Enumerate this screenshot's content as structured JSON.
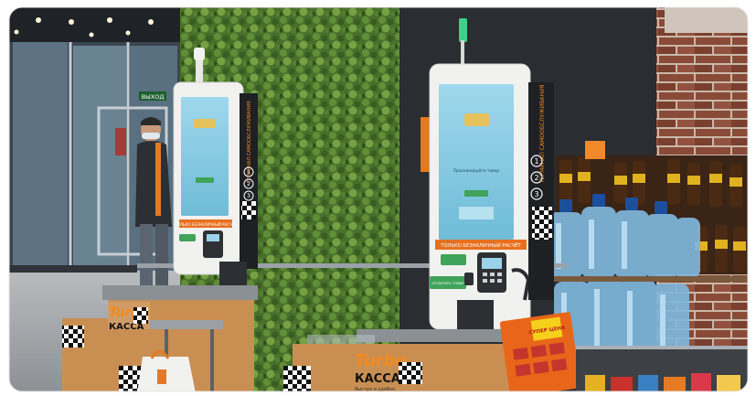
{
  "exit_sign": "ВЫХОД",
  "kiosk_left": {
    "banner": "ТОЛЬКО БЕЗНАЛИЧНЫЙ РАСЧЁТ",
    "side_panel": "ТЕРМИНАЛ САМООБСЛУЖИВАНИЯ",
    "steps": [
      "1",
      "2",
      "3"
    ]
  },
  "kiosk_right": {
    "screen_prompt": "Просканируйте товар",
    "banner": "ТОЛЬКО БЕЗНАЛИЧНЫЙ РАСЧЁТ",
    "side_panel": "ТЕРМИНАЛ САМООБСЛУЖИВАНИЯ",
    "steps": [
      "1",
      "2",
      "3"
    ],
    "button_label": "ОПЛАТИТЬ ТОВАР"
  },
  "counter_left": {
    "brand_top": "Turbo",
    "brand_bottom": "КАССА"
  },
  "counter_right": {
    "brand_top": "Turbo",
    "brand_bottom": "КАССА",
    "tagline": "быстро и удобно"
  },
  "price_tag": "СУПЕР ЦЕНА",
  "colors": {
    "wall_dark": "#2a2d31",
    "greenery": "#4f7a2e",
    "brick": "#8a4a38",
    "kiosk_white": "#f1f1ef",
    "screen_blue": "#8fcfe6",
    "brand_orange": "#f28a1e",
    "counter_wood": "#c98f52",
    "water_blue": "#7fb7dd"
  }
}
